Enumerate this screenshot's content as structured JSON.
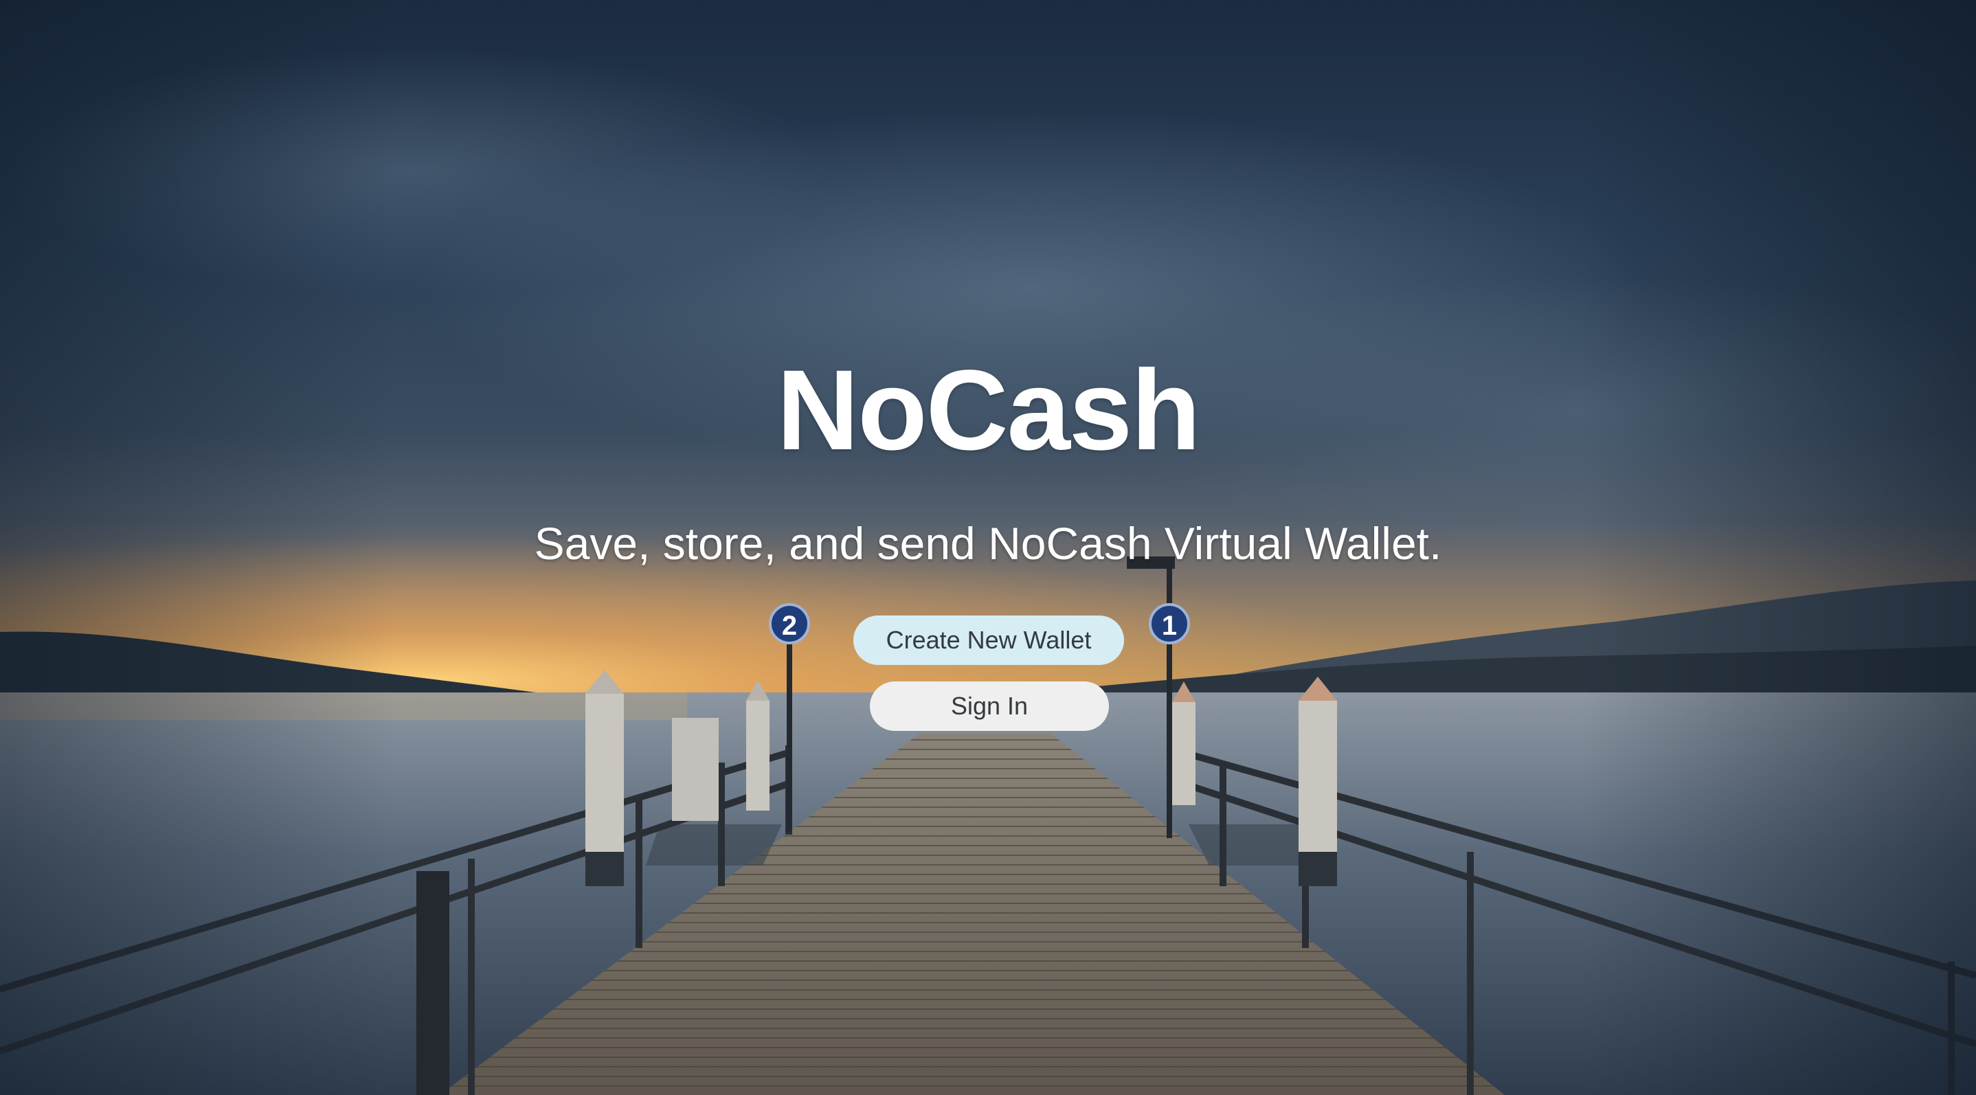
{
  "hero": {
    "title": "NoCash",
    "tagline": "Save, store, and send NoCash Virtual Wallet."
  },
  "actions": {
    "create_wallet_label": "Create New Wallet",
    "sign_in_label": "Sign In"
  },
  "background": {
    "scene": "pier-at-dusk",
    "sign_left_number": "2",
    "sign_right_number": "1"
  },
  "colors": {
    "title": "#ffffff",
    "create_button_bg": "#d6edf4",
    "sign_in_button_bg": "#efefef",
    "button_text": "#333a40"
  }
}
